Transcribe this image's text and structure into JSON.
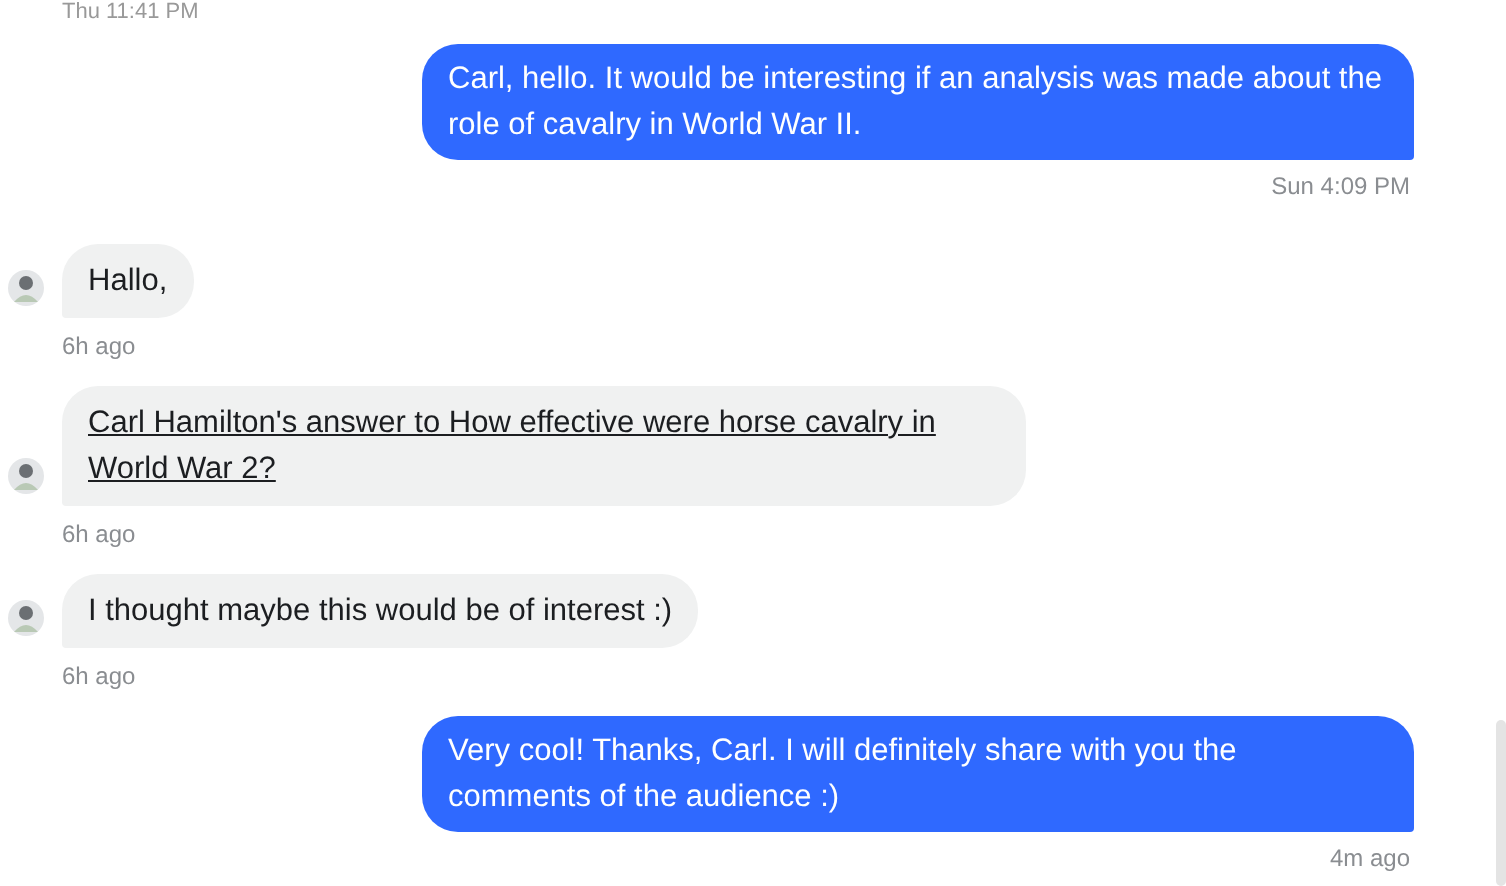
{
  "top_timestamp": "Thu 11:41 PM",
  "messages": [
    {
      "kind": "out",
      "text": "Carl, hello. It would be interesting if an analysis was made about the role of cavalry in World War II.",
      "time": "Sun 4:09 PM",
      "link": false
    },
    {
      "kind": "in",
      "text": "Hallo,",
      "time": "6h ago",
      "link": false
    },
    {
      "kind": "in",
      "text": "Carl Hamilton's answer to How effective were horse cavalry in World War 2?",
      "time": "6h ago",
      "link": true
    },
    {
      "kind": "in",
      "text": "I thought maybe this would be of interest :)",
      "time": "6h ago",
      "link": false
    },
    {
      "kind": "out",
      "text": "Very cool! Thanks, Carl. I will definitely share with you the comments of the audience :)",
      "time": "4m ago",
      "link": false
    }
  ]
}
